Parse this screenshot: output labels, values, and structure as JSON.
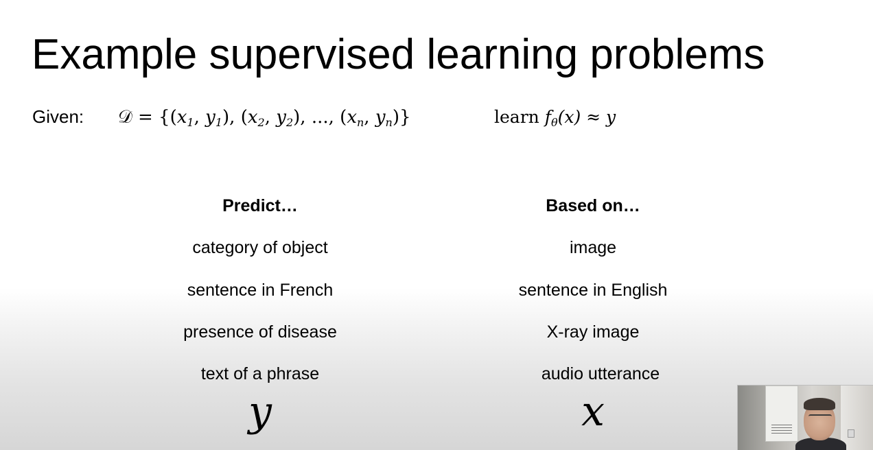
{
  "slide": {
    "title": "Example supervised learning problems",
    "given_label": "Given:",
    "dataset": {
      "prefix": "𝒟 = {(",
      "x1": "x",
      "x1_sub": "1",
      "y1": "y",
      "y1_sub": "1",
      "x2": "x",
      "x2_sub": "2",
      "y2": "y",
      "y2_sub": "2",
      "ellipsis": "...",
      "xn": "x",
      "xn_sub": "n",
      "yn": "y",
      "yn_sub": "n"
    },
    "learn": {
      "word": "learn",
      "f": "f",
      "theta": "θ",
      "rest": "(x) ≈ y"
    },
    "predict_header": "Predict…",
    "based_on_header": "Based on…",
    "predict_items": [
      "category of object",
      "sentence in French",
      "presence of disease",
      "text of a phrase"
    ],
    "based_on_items": [
      "image",
      "sentence in English",
      "X-ray image",
      "audio utterance"
    ],
    "predict_symbol": "y",
    "based_on_symbol": "x"
  }
}
